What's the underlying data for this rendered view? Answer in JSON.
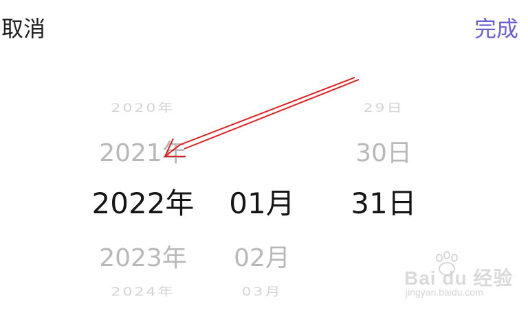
{
  "topbar": {
    "cancel_label": "取消",
    "done_label": "完成",
    "done_color": "#6b5fd6"
  },
  "picker": {
    "years": [
      "2020年",
      "2021年",
      "2022年",
      "2023年",
      "2024年"
    ],
    "months": [
      "",
      "",
      "01月",
      "02月",
      "03月"
    ],
    "days": [
      "29日",
      "30日",
      "31日",
      "",
      ""
    ],
    "selected": {
      "year": "2022年",
      "month": "01月",
      "day": "31日"
    }
  },
  "annotation": {
    "arrow_color": "#e01e1e",
    "icon": "red-arrow-icon"
  },
  "watermark": {
    "logo_text": "Bai du 经验",
    "url_text": "jingyan.baidu.com"
  }
}
